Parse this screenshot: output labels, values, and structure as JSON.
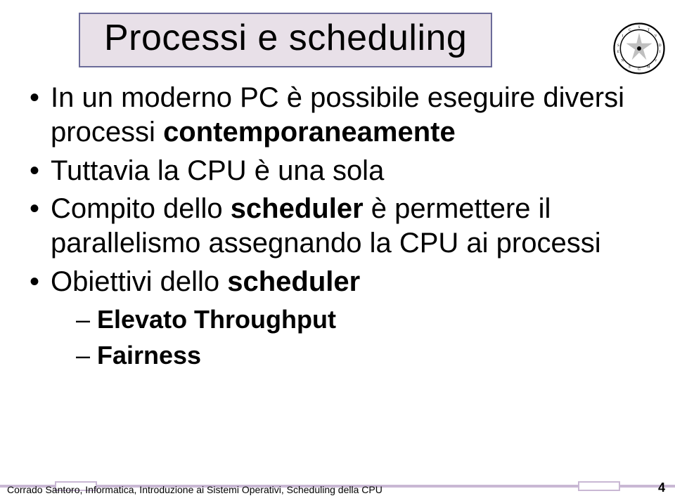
{
  "title": "Processi e scheduling",
  "bullets": [
    {
      "pre": "In un moderno PC è possibile eseguire diversi processi ",
      "bold": "contemporaneamente",
      "post": ""
    },
    {
      "pre": "Tuttavia la CPU è una sola",
      "bold": "",
      "post": ""
    },
    {
      "pre": "Compito dello ",
      "bold": "scheduler",
      "post": " è permettere il parallelismo assegnando la CPU ai processi"
    },
    {
      "pre": "Obiettivi dello ",
      "bold": "scheduler",
      "post": ""
    }
  ],
  "sub_bullets": [
    {
      "pre": "",
      "bold": "Elevato Throughput",
      "post": ""
    },
    {
      "pre": "",
      "bold": "Fairness",
      "post": ""
    }
  ],
  "footer": "Corrado Santoro, Informatica, Introduzione ai Sistemi Operativi, Scheduling della CPU",
  "page_num": "4"
}
